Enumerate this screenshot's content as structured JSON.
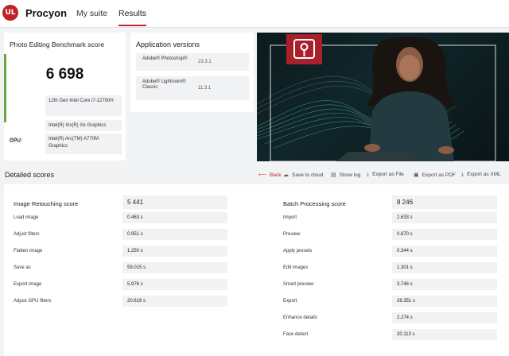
{
  "nav": {
    "logo_text": "UL",
    "brand": "Procyon",
    "tabs": [
      {
        "label": "My suite"
      },
      {
        "label": "Results"
      }
    ]
  },
  "score_card": {
    "title": "Photo Editing Benchmark score",
    "score": "6 698",
    "cpu_label": "CPU:",
    "cpu_value": "12th Gen Intel Core i7-12700H",
    "gpu_label": "GPU:",
    "gpu_value_1": "Intel(R) Iris(R) Xe Graphics",
    "gpu_value_2": "Intel(R) Arc(TM) A770M Graphics"
  },
  "versions": {
    "title": "Application versions",
    "apps": [
      {
        "name": "Adobe® Photoshop®",
        "version": "23.3.1"
      },
      {
        "name": "Adobe® Lightroom® Classic",
        "version": "11.3.1"
      }
    ]
  },
  "detailed": {
    "title": "Detailed scores",
    "actions": [
      {
        "label": "Back",
        "icon": "arrow-left-icon",
        "glyph": "⟵"
      },
      {
        "label": "Save to cloud",
        "icon": "cloud-icon",
        "glyph": "☁"
      },
      {
        "label": "Show log",
        "icon": "log-icon",
        "glyph": "▤"
      },
      {
        "label": "Export as File",
        "icon": "download-icon",
        "glyph": "⤓"
      },
      {
        "label": "Export as PDF",
        "icon": "pdf-icon",
        "glyph": "▣"
      },
      {
        "label": "Export as XML",
        "icon": "download-icon",
        "glyph": "⤓"
      }
    ]
  },
  "retouching": {
    "head_label": "Image Retouching score",
    "head_value": "5 441",
    "rows": [
      {
        "label": "Load image",
        "value": "0.463 s"
      },
      {
        "label": "Adjust filters",
        "value": "0.951 s"
      },
      {
        "label": "Flatten image",
        "value": "1.250 s"
      },
      {
        "label": "Save as",
        "value": "59.015 s"
      },
      {
        "label": "Export image",
        "value": "5.976 s"
      },
      {
        "label": "Adjust GPU filters",
        "value": "20.619 s"
      }
    ]
  },
  "batch": {
    "head_label": "Batch Processing score",
    "head_value": "8 246",
    "rows": [
      {
        "label": "Import",
        "value": "2.633 s"
      },
      {
        "label": "Preview",
        "value": "0.670 s"
      },
      {
        "label": "Apply presets",
        "value": "0.344 s"
      },
      {
        "label": "Edit images",
        "value": "1.301 s"
      },
      {
        "label": "Smart preview",
        "value": "3.746 s"
      },
      {
        "label": "Export",
        "value": "26.351 s"
      },
      {
        "label": "Enhance details",
        "value": "2.274 s"
      },
      {
        "label": "Face detect",
        "value": "20.113 s"
      }
    ]
  },
  "colors": {
    "brand_red": "#c0202a",
    "score_green": "#6aa842"
  }
}
